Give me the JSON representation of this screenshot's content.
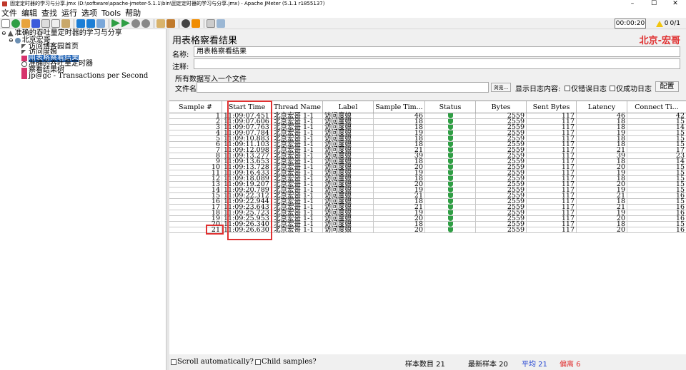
{
  "window": {
    "title": "固定定时器的学习与分享.jmx (D:\\software\\apache-jmeter-5.1.1\\bin\\固定定时器的学习与分享.jmx) - Apache JMeter (5.1.1 r1855137)",
    "controls": [
      "–",
      "☐",
      "✕"
    ]
  },
  "menu": [
    "文件",
    "编辑",
    "查找",
    "运行",
    "选项",
    "Tools",
    "帮助"
  ],
  "toolbar": {
    "timer": "00:00:20",
    "warnings": "0",
    "threads": "0/1"
  },
  "tree": {
    "items": [
      {
        "label": "准确的吞吐量定时器的学习与分享"
      },
      {
        "label": "北京宏哥"
      },
      {
        "label": "访问博客园首页"
      },
      {
        "label": "访问度娘"
      },
      {
        "label": "用表格察看结果"
      },
      {
        "label": "准确的吞吐量定时器"
      },
      {
        "label": "察看结果树"
      },
      {
        "label": "jp@gc - Transactions per Second"
      }
    ]
  },
  "panel": {
    "title": "用表格察看结果",
    "brand": "北京-宏哥",
    "name_label": "名称:",
    "name_value": "用表格察看结果",
    "comment_label": "注释:",
    "comment_value": "",
    "write_all_label": "所有数据写入一个文件",
    "filename_label": "文件名",
    "filename_value": "",
    "browse_label": "浏览...",
    "log_content_label": "显示日志内容:",
    "errors_only_label": "仅错误日志",
    "success_only_label": "仅成功日志",
    "configure_label": "配置"
  },
  "table": {
    "headers": [
      "Sample #",
      "Start Time",
      "Thread Name",
      "Label",
      "Sample Tim...",
      "Status",
      "Bytes",
      "Sent Bytes",
      "Latency",
      "Connect Ti..."
    ],
    "rows": [
      [
        "1",
        "11:09:07.451",
        "北京宏哥 1-1",
        "访问度娘",
        "46",
        "ok",
        "2559",
        "117",
        "46",
        "42"
      ],
      [
        "2",
        "11:09:07.606",
        "北京宏哥 1-1",
        "访问度娘",
        "18",
        "ok",
        "2559",
        "117",
        "18",
        "15"
      ],
      [
        "3",
        "11:09:07.763",
        "北京宏哥 1-1",
        "访问度娘",
        "18",
        "ok",
        "2559",
        "117",
        "18",
        "14"
      ],
      [
        "4",
        "11:09:07.784",
        "北京宏哥 1-1",
        "访问度娘",
        "19",
        "ok",
        "2559",
        "117",
        "19",
        "15"
      ],
      [
        "5",
        "11:09:10.883",
        "北京宏哥 1-1",
        "访问度娘",
        "18",
        "ok",
        "2559",
        "117",
        "18",
        "15"
      ],
      [
        "6",
        "11:09:11.103",
        "北京宏哥 1-1",
        "访问度娘",
        "18",
        "ok",
        "2559",
        "117",
        "18",
        "15"
      ],
      [
        "7",
        "11:09:12.098",
        "北京宏哥 1-1",
        "访问度娘",
        "21",
        "ok",
        "2559",
        "117",
        "21",
        "17"
      ],
      [
        "8",
        "11:09:13.277",
        "北京宏哥 1-1",
        "访问度娘",
        "39",
        "ok",
        "2559",
        "117",
        "39",
        "23"
      ],
      [
        "9",
        "11:09:13.653",
        "北京宏哥 1-1",
        "访问度娘",
        "18",
        "ok",
        "2559",
        "117",
        "18",
        "14"
      ],
      [
        "10",
        "11:09:13.728",
        "北京宏哥 1-1",
        "访问度娘",
        "20",
        "ok",
        "2559",
        "117",
        "20",
        "15"
      ],
      [
        "11",
        "11:09:16.433",
        "北京宏哥 1-1",
        "访问度娘",
        "19",
        "ok",
        "2559",
        "117",
        "19",
        "15"
      ],
      [
        "12",
        "11:09:18.089",
        "北京宏哥 1-1",
        "访问度娘",
        "18",
        "ok",
        "2559",
        "117",
        "18",
        "15"
      ],
      [
        "13",
        "11:09:19.207",
        "北京宏哥 1-1",
        "访问度娘",
        "20",
        "ok",
        "2559",
        "117",
        "20",
        "15"
      ],
      [
        "14",
        "11:09:20.789",
        "北京宏哥 1-1",
        "访问度娘",
        "19",
        "ok",
        "2559",
        "117",
        "19",
        "15"
      ],
      [
        "15",
        "11:09:22.312",
        "北京宏哥 1-1",
        "访问度娘",
        "21",
        "ok",
        "2559",
        "117",
        "21",
        "16"
      ],
      [
        "16",
        "11:09:22.944",
        "北京宏哥 1-1",
        "访问度娘",
        "18",
        "ok",
        "2559",
        "117",
        "18",
        "15"
      ],
      [
        "17",
        "11:09:23.643",
        "北京宏哥 1-1",
        "访问度娘",
        "21",
        "ok",
        "2559",
        "117",
        "21",
        "16"
      ],
      [
        "18",
        "11:09:25.723",
        "北京宏哥 1-1",
        "访问度娘",
        "19",
        "ok",
        "2559",
        "117",
        "19",
        "16"
      ],
      [
        "19",
        "11:09:25.953",
        "北京宏哥 1-1",
        "访问度娘",
        "20",
        "ok",
        "2559",
        "117",
        "20",
        "16"
      ],
      [
        "20",
        "11:09:26.340",
        "北京宏哥 1-1",
        "访问度娘",
        "18",
        "ok",
        "2559",
        "117",
        "18",
        "15"
      ],
      [
        "21",
        "11:09:26.630",
        "北京宏哥 1-1",
        "访问度娘",
        "20",
        "ok",
        "2559",
        "117",
        "20",
        "16"
      ]
    ]
  },
  "footer": {
    "scroll_label": "Scroll automatically?",
    "child_label": "Child samples?",
    "sample_count": "样本数目 21",
    "latest_sample": "最新样本 20",
    "average": "平均 21",
    "deviation": "偏离 6"
  },
  "colors": {
    "brand": "#e03131",
    "average": "#1c3fd1",
    "deviation": "#e03131",
    "selection": "#1a5fb4",
    "status_ok": "#2f9e44"
  }
}
